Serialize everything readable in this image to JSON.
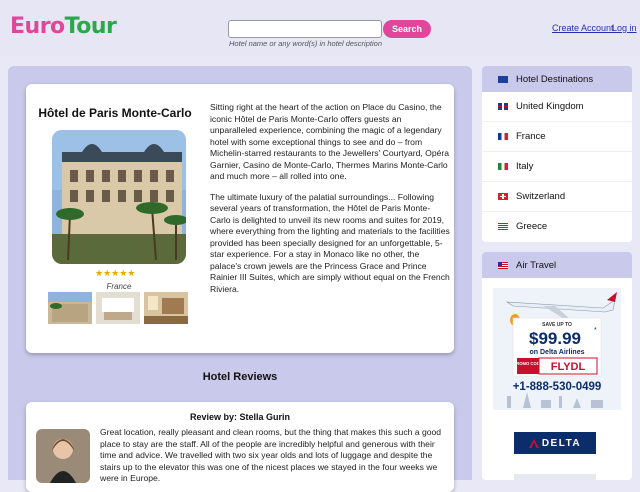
{
  "header": {
    "logo_part1": "Euro",
    "logo_part2": "Tour",
    "search": {
      "value": "",
      "placeholder": "",
      "hint": "Hotel name or any word(s) in hotel description",
      "button_label": "Search"
    },
    "create_account": "Create Account",
    "login": "Log in"
  },
  "hotel": {
    "name": "Hôtel de Paris Monte-Carlo",
    "rating_stars": "★★★★★",
    "rating": 5,
    "country": "France",
    "paragraph1": "Sitting right at the heart of the action on Place du Casino, the iconic Hôtel de Paris Monte-Carlo offers guests an unparalleled experience, combining the magic of a legendary hotel with some exceptional things to see and do – from Michelin-starred restaurants to the Jewellers' Courtyard, Opéra Garnier, Casino de Monte-Carlo, Thermes Marins Monte-Carlo and much more – all rolled into one.",
    "paragraph2": "The ultimate luxury of the palatial surroundings... Following several years of transformation, the Hôtel de Paris Monte-Carlo is delighted to unveil its new rooms and suites for 2019, where everything from the lighting and materials to the facilities provided has been specially designed for an unforgettable, 5-star experience. For a stay in Monaco like no other, the palace's crown jewels are the Princess Grace and Prince Rainier III Suites, which are simply without equal on the French Riviera."
  },
  "reviews": {
    "heading": "Hotel Reviews",
    "items": [
      {
        "by": "Review by: Stella Gurin",
        "text": "Great location, really pleasant and clean rooms, but the thing that makes this such a good place to stay are the staff. All of the people are incredibly helpful and generous with their time and advice. We travelled with two six year olds and lots of luggage and despite the stairs up to the elevator this was one of the nicest places we stayed in the four weeks we were in Europe."
      }
    ]
  },
  "sidebar": {
    "destinations_title": "Hotel Destinations",
    "destinations": [
      {
        "label": "United Kingdom",
        "flag": "uk-flag-icon"
      },
      {
        "label": "France",
        "flag": "france-flag-icon"
      },
      {
        "label": "Italy",
        "flag": "italy-flag-icon"
      },
      {
        "label": "Switzerland",
        "flag": "switzerland-flag-icon"
      },
      {
        "label": "Greece",
        "flag": "greece-flag-icon"
      }
    ],
    "air_travel_title": "Air Travel",
    "ad": {
      "save_up_to": "SAVE UP TO",
      "price": "$99.99",
      "asterisk": "*",
      "airline_line": "on Delta Airlines",
      "promo_label": "PROMO CODE",
      "promo_code": "FLYDL",
      "phone": "+1-888-530-0499"
    },
    "delta_logo": "DELTA"
  },
  "colors": {
    "brand_pink": "#e0469a",
    "brand_green": "#2aa84a",
    "panel": "#c9c9ec",
    "link": "#2233aa",
    "delta_red": "#c8102e",
    "delta_navy": "#0b2d6b"
  }
}
